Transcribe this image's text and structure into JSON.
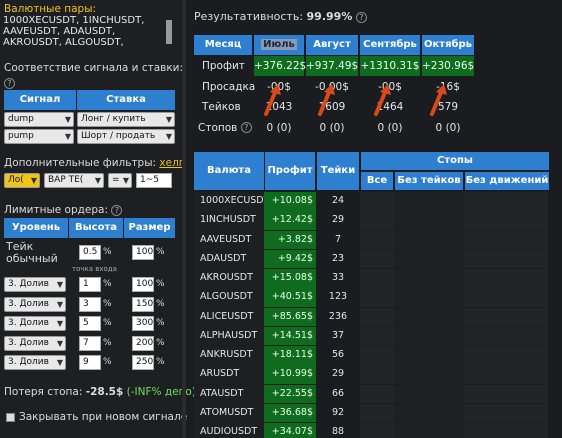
{
  "left": {
    "pairs_label": "Валютные пары:",
    "pairs_text": [
      "1000XECUSDT, 1INCHUSDT,",
      "AAVEUSDT, ADAUSDT,",
      "AKROUSDT, ALGOUSDT,"
    ],
    "signal_label": "Соответствие сигнала и ставки:",
    "signal_header": "Сигнал",
    "bet_header": "Ставка",
    "signal_rows": [
      {
        "signal": "dump",
        "bet": "Лонг / купить"
      },
      {
        "signal": "pump",
        "bet": "Шорт / продать"
      }
    ],
    "filters_label": "Дополнительные фильтры:",
    "filters_help": "хелп",
    "filter_a": "Ло(",
    "filter_b": "ВАР ТЕ(",
    "filter_c": "=",
    "filter_d": "1~5",
    "limits_label": "Лимитные ордера:",
    "level_header": "Уровень",
    "height_header": "Высота",
    "size_header": "Размер",
    "take_label": "Тейк обычный",
    "take_height": "0.5",
    "take_size": "100",
    "entry_note": "точка входа",
    "orders": [
      {
        "level": "3. Долив",
        "height": "1",
        "size": "100"
      },
      {
        "level": "3. Долив",
        "height": "3",
        "size": "150"
      },
      {
        "level": "3. Долив",
        "height": "5",
        "size": "300"
      },
      {
        "level": "3. Долив",
        "height": "7",
        "size": "200"
      },
      {
        "level": "3. Долив",
        "height": "9",
        "size": "250"
      }
    ],
    "pct_sign": "%",
    "loss_label": "Потеря стопа:",
    "loss_value": "-28.5$",
    "loss_extra": "(-INF% депо)",
    "close_label": "Закрывать при новом сигнале"
  },
  "right": {
    "perf_label": "Результативность:",
    "perf_value": "99.99%",
    "month_header": "Месяц",
    "months": [
      "Июль",
      "Август",
      "Сентябрь",
      "Октябрь"
    ],
    "rows": [
      {
        "label": "Профит",
        "values": [
          "+376.22$",
          "+937.49$",
          "+1310.31$",
          "+230.96$"
        ]
      },
      {
        "label": "Просадка",
        "values": [
          "-00$",
          "-0.00$",
          "-00$",
          "-16$"
        ]
      },
      {
        "label": "Тейков",
        "values": [
          "1043",
          "1609",
          "1464",
          "579"
        ]
      },
      {
        "label": "Стопов",
        "values": [
          "0 (0)",
          "0 (0)",
          "0 (0)",
          "0 (0)"
        ]
      }
    ],
    "table_headers": {
      "currency": "Валюта",
      "profit": "Профит",
      "takes": "Тейки",
      "stops": "Стопы",
      "all": "Все",
      "no_takes": "Без тейков",
      "no_moves": "Без движений"
    },
    "table": [
      {
        "cur": "1000XECUSDT",
        "profit": "+10.08$",
        "takes": "24"
      },
      {
        "cur": "1INCHUSDT",
        "profit": "+12.42$",
        "takes": "29"
      },
      {
        "cur": "AAVEUSDT",
        "profit": "+3.82$",
        "takes": "7"
      },
      {
        "cur": "ADAUSDT",
        "profit": "+9.42$",
        "takes": "23"
      },
      {
        "cur": "AKROUSDT",
        "profit": "+15.08$",
        "takes": "33"
      },
      {
        "cur": "ALGOUSDT",
        "profit": "+40.51$",
        "takes": "123"
      },
      {
        "cur": "ALICEUSDT",
        "profit": "+85.65$",
        "takes": "236"
      },
      {
        "cur": "ALPHAUSDT",
        "profit": "+14.51$",
        "takes": "37"
      },
      {
        "cur": "ANKRUSDT",
        "profit": "+18.11$",
        "takes": "56"
      },
      {
        "cur": "ARUSDT",
        "profit": "+10.99$",
        "takes": "29"
      },
      {
        "cur": "ATAUSDT",
        "profit": "+22.55$",
        "takes": "66"
      },
      {
        "cur": "ATOMUSDT",
        "profit": "+36.68$",
        "takes": "92"
      },
      {
        "cur": "AUDIOUSDT",
        "profit": "+34.07$",
        "takes": "88"
      }
    ]
  },
  "colors": {
    "accent": "#2f7fd0",
    "profit_bg": "#0f6b1e",
    "arrow": "#d94a1a",
    "highlight": "#f0c419",
    "loss_green": "#6ede5a"
  }
}
